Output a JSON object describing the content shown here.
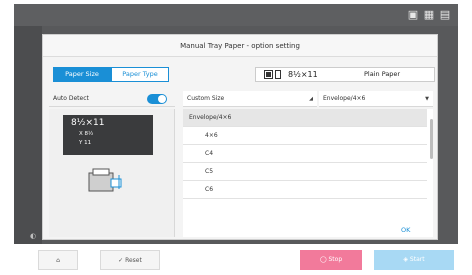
{
  "dialog": {
    "title": "Manual Tray Paper - option setting",
    "tabs": [
      {
        "label": "Paper Size"
      },
      {
        "label": "Paper Type"
      }
    ],
    "current_size": "8½×11",
    "current_type": "Plain Paper",
    "auto_detect": {
      "label": "Auto Detect",
      "on": true
    },
    "dropdowns": [
      {
        "label": "Custom Size"
      },
      {
        "label": "Envelope/4×6"
      }
    ],
    "preview": {
      "size": "8½×11",
      "x_value": "X 8½",
      "y_value": "Y 11"
    },
    "list": [
      {
        "label": "Envelope/4×6",
        "group": true
      },
      {
        "label": "4×6",
        "group": false
      },
      {
        "label": "C4",
        "group": false
      },
      {
        "label": "C5",
        "group": false
      },
      {
        "label": "C6",
        "group": false
      }
    ],
    "ok_label": "OK"
  },
  "bottom": {
    "reset_label": "Reset",
    "stop_label": "Stop",
    "start_label": "Start"
  },
  "colors": {
    "accent": "#1a8fd6",
    "stop": "#f27a9b",
    "start": "#a8d9f4"
  }
}
